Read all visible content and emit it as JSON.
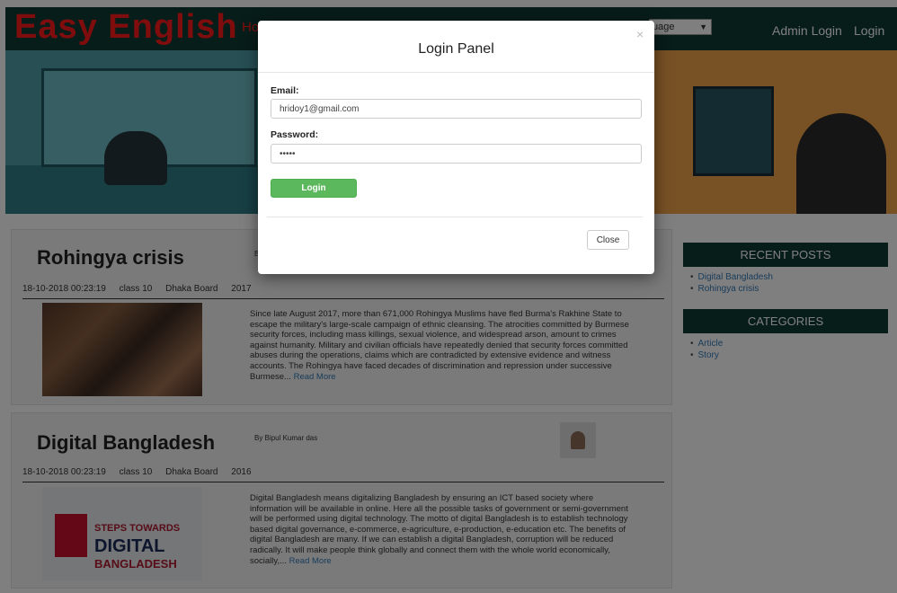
{
  "navbar": {
    "brand": "Easy English",
    "home_link": "Ho",
    "language_select": "uage",
    "admin_login": "Admin Login",
    "login": "Login"
  },
  "posts": [
    {
      "title": "Rohingya crisis",
      "byline": "B",
      "date": "18-10-2018 00:23:19",
      "class": "class 10",
      "board": "Dhaka Board",
      "year": "2017",
      "excerpt": "Since late August 2017, more than 671,000 Rohingya Muslims have fled Burma's Rakhine State to escape the military's large-scale campaign of ethnic cleansing. The atrocities committed by Burmese security forces, including mass killings, sexual violence, and widespread arson, amount to crimes against humanity. Military and civilian officials have repeatedly denied that security forces committed abuses during the operations, claims which are contradicted by extensive evidence and witness accounts. The Rohingya have faced decades of discrimination and repression under successive Burmese...",
      "read_more": "Read More"
    },
    {
      "title": "Digital Bangladesh",
      "byline": "By   Bipul Kumar das",
      "date": "18-10-2018 00:23:19",
      "class": "class 10",
      "board": "Dhaka Board",
      "year": "2016",
      "excerpt": "Digital Bangladesh means digitalizing Bangladesh by ensuring an ICT based society where information will be available in online. Here all the possible tasks of government or semi-government will be performed using digital technology. The motto of digital Bangladesh is to establish technology based digital governance, e-commerce, e-agriculture, e-production, e-education etc. The benefits of digital Bangladesh are many. If we can establish a digital Bangladesh, corruption will be reduced radically. It will make people think globally and connect them with the whole world economically, socially,...",
      "read_more": "Read More",
      "thumb": {
        "line1": "STEPS TOWARDS",
        "line2": "DIGITAL",
        "line3": "BANGLADESH"
      }
    }
  ],
  "sidebar": {
    "recent_posts_title": "RECENT POSTS",
    "recent_posts": [
      "Digital Bangladesh",
      "Rohingya crisis"
    ],
    "categories_title": "CATEGORIES",
    "categories": [
      "Article",
      "Story"
    ]
  },
  "modal": {
    "close_x": "×",
    "title": "Login Panel",
    "email_label": "Email:",
    "email_value": "hridoy1@gmail.com",
    "password_label": "Password:",
    "password_value": "•••••",
    "login_button": "Login",
    "close_button": "Close"
  },
  "colors": {
    "navbar_bg": "#0f3a34",
    "brand": "#ff1a1a",
    "login_button": "#5cb85c",
    "link": "#337ab7"
  }
}
